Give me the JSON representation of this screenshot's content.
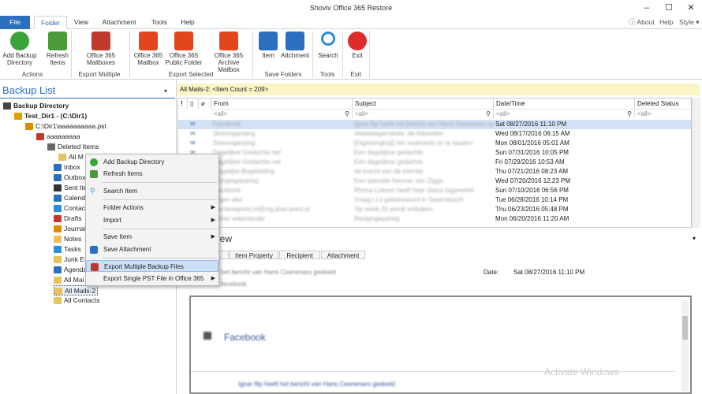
{
  "window": {
    "title": "Shoviv Office 365 Restore",
    "minimize": "–",
    "maximize": "☐",
    "close": "✕"
  },
  "tabs": [
    "File",
    "Folder",
    "View",
    "Attachment",
    "Tools",
    "Help"
  ],
  "top_right": {
    "about": "About",
    "help": "Help",
    "style": "Style"
  },
  "ribbon": {
    "buttons": [
      {
        "label": "Add Backup\nDirectory",
        "icon": "add-icon",
        "color": "#3aa33a"
      },
      {
        "label": "Refresh\nItems",
        "icon": "refresh-icon",
        "color": "#4a9a3a"
      },
      {
        "label": "Office 365\nMailboxes",
        "icon": "office-export-icon",
        "color": "#c0392b"
      },
      {
        "label": "Office 365\nMailbox",
        "icon": "office-mailbox-icon",
        "color": "#e2461c"
      },
      {
        "label": "Office 365\nPublic Folder",
        "icon": "office-public-folder-icon",
        "color": "#e2461c"
      },
      {
        "label": "Office 365\nArchive Mailbox",
        "icon": "office-archive-icon",
        "color": "#e2461c"
      },
      {
        "label": "Item",
        "icon": "save-item-icon",
        "color": "#2b6fc0"
      },
      {
        "label": "Attchment",
        "icon": "save-attachment-icon",
        "color": "#2b6fc0"
      },
      {
        "label": "Search",
        "icon": "search-icon",
        "color": "#2b8fd8"
      },
      {
        "label": "Exit",
        "icon": "power-icon",
        "color": "#e02b2b"
      }
    ],
    "groups": [
      "Actions",
      "Export Multiple",
      "Export Selected",
      "Save Folders",
      "Tools",
      "Exit"
    ]
  },
  "backup_list": {
    "title": "Backup List"
  },
  "tree": [
    "Backup Directory",
    "Test_Dir1 - (C:\\Dir1)",
    "C:\\Dir1\\aaaaaaaaaa.pst",
    "aaaaaaaaa",
    "Deleted Items",
    "All M",
    "Inbox",
    "Outbox",
    "Sent Ite",
    "Calendar",
    "Contac",
    "Drafts",
    "Journal",
    "Notes",
    "Tasks",
    "Junk E-",
    "Agenda",
    "All Mai",
    "All Mails-2",
    "All Contacts"
  ],
  "grid": {
    "banner": "All Mails-2: <Item Count = 209>",
    "columns": [
      "From",
      "Subject",
      "Date/Time",
      "Deleted Status"
    ],
    "filter": "<all>",
    "rows": [
      {
        "from": "Facebook",
        "subject": "Ignar flip heeft het bericht van Hans Ceenenaro gedeeld",
        "date": "Sat 08/27/2016 11:10 PM",
        "sel": true
      },
      {
        "from": "Stoexoganaing",
        "subject": "Veipaldagstraliate: de Adswalter",
        "date": "Wed 08/17/2016 06:15 AM"
      },
      {
        "from": "Stoexoganaing",
        "subject": "[Digesongbuji] Ver ouderaols on te tasaten",
        "date": "Mon 08/01/2016 05:01 AM"
      },
      {
        "from": "Dagelijker Gedachte.net",
        "subject": "Een dagelijkse gedachte",
        "date": "Sun 07/31/2016 10:05 PM"
      },
      {
        "from": "Dagelijker Gedachte.net",
        "subject": "Een dagelijkse gedachte",
        "date": "Fri 07/29/2016 10:53 AM"
      },
      {
        "from": "Mogelijke Begeleiding",
        "subject": "de kracht van de intentie",
        "date": "Thu 07/21/2016 08:23 AM"
      },
      {
        "from": "Bezigingeparing",
        "subject": "Een speciale herover van Ziggo",
        "date": "Wed 07/20/2016 12:23 PM"
      },
      {
        "from": "Facebook",
        "subject": "Rhona Lukson heeft haar status bijgewerkt",
        "date": "Sun 07/10/2016 06:56 PM"
      },
      {
        "from": "Tegen abe",
        "subject": "Vraag r.t.s gebaresourd in Swarnaboch",
        "date": "Tue 06/28/2016 10:14 PM"
      },
      {
        "from": "Reclamepoint.nl@mg.plan-point.nl",
        "subject": "Tip week 25 wordt ontkaken",
        "date": "Thu 06/23/2016 05:48 PM"
      },
      {
        "from": "dokter waterlander",
        "subject": "Bezigingeparing",
        "date": "Mon 06/20/2016 11:20 AM"
      }
    ]
  },
  "preview": {
    "title": "view",
    "tabs": [
      "Item Property",
      "Recipient",
      "Attachment"
    ],
    "subject_line": "het bericht van Hans Ceenenaro gedeeld",
    "from_line": "facebook",
    "date_label": "Date:",
    "date_value": "Sat 08/27/2016 11:10 PM",
    "body_title": "Facebook",
    "body_line": "Ignar flip heeft het bericht van Hans Ceenenaro gedeeld"
  },
  "context_menu": {
    "items": [
      "Add Backup Directory",
      "Refresh Items",
      "Search Item",
      "Folder Actions",
      "Import",
      "Save Item",
      "Save Attachment",
      "Export Multiple Backup Files",
      "Export Single PST File in Office 365"
    ]
  },
  "watermark": "Activate Windows"
}
